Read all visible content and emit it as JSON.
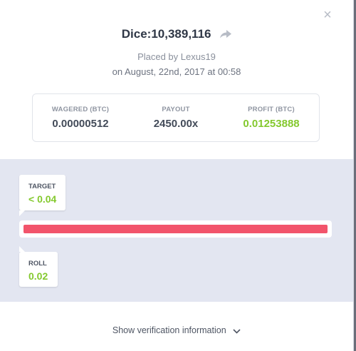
{
  "header": {
    "title": "Dice:10,389,116",
    "placed_by": "Placed by Lexus19",
    "date": "on August, 22nd, 2017 at 00:58",
    "close_glyph": "×"
  },
  "stats": [
    {
      "label": "WAGERED (BTC)",
      "value": "0.00000512"
    },
    {
      "label": "PAYOUT",
      "value": "2450.00x"
    },
    {
      "label": "PROFIT (BTC)",
      "value": "0.01253888"
    }
  ],
  "game": {
    "target_label": "TARGET",
    "target_value": "< 0.04",
    "roll_label": "ROLL",
    "roll_value": "0.02"
  },
  "footer": {
    "verify_label": "Show verification information"
  },
  "colors": {
    "accent_green": "#84c92e",
    "bar_red": "#f2546b",
    "panel_bg": "#e3e6f1"
  },
  "icons": [
    "close-icon",
    "share-arrow-icon",
    "chevron-down-icon"
  ]
}
